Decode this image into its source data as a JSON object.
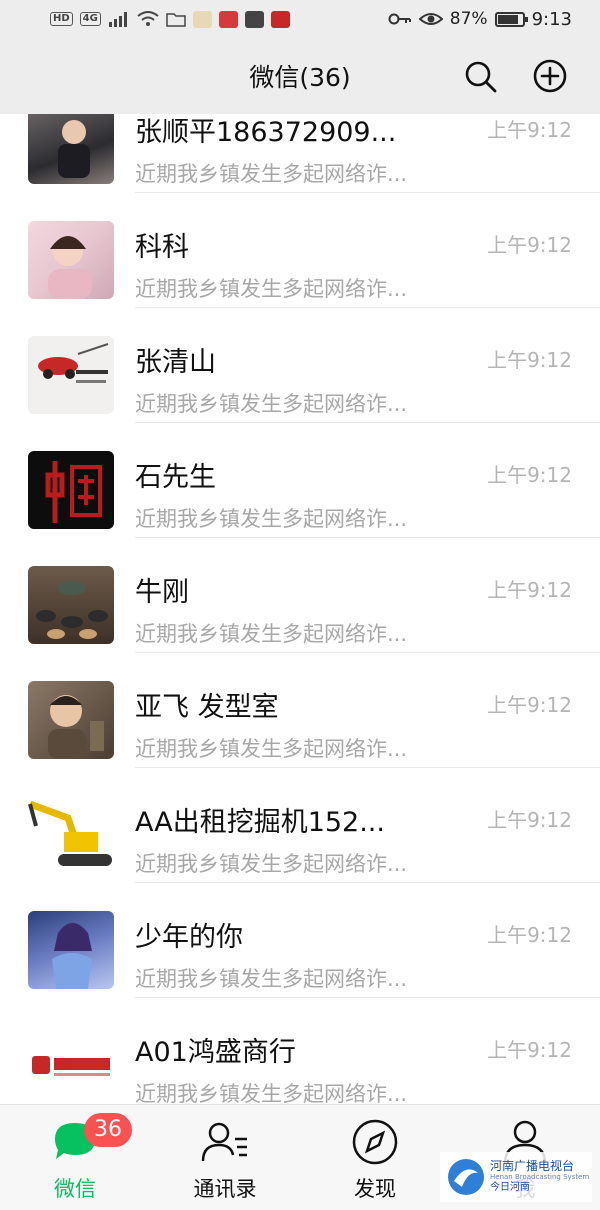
{
  "status_bar": {
    "left_chips": [
      "HD",
      "4G"
    ],
    "battery_percent_label": "87%",
    "battery_level": 0.87,
    "time": "9:13",
    "icons": [
      "signal-icon",
      "wifi-icon",
      "folder-icon",
      "app-icon",
      "app-icon",
      "app-icon",
      "app-icon",
      "key-icon",
      "eye-icon",
      "battery-icon"
    ]
  },
  "header": {
    "title": "微信(36)",
    "search_icon": "search-icon",
    "add_icon": "add-circle-icon"
  },
  "chats": [
    {
      "name": "张顺平186372909...",
      "preview": "近期我乡镇发生多起网络诈...",
      "time": "上午9:12",
      "avatar": "child-photo"
    },
    {
      "name": "科科",
      "preview": "近期我乡镇发生多起网络诈...",
      "time": "上午9:12",
      "avatar": "woman-selfie"
    },
    {
      "name": "张清山",
      "preview": "近期我乡镇发生多起网络诈...",
      "time": "上午9:12",
      "avatar": "car-logo"
    },
    {
      "name": "石先生",
      "preview": "近期我乡镇发生多起网络诈...",
      "time": "上午9:12",
      "avatar": "calligraphy-zhongguo"
    },
    {
      "name": "牛刚",
      "preview": "近期我乡镇发生多起网络诈...",
      "time": "上午9:12",
      "avatar": "tea-set"
    },
    {
      "name": "亚飞 发型室",
      "preview": "近期我乡镇发生多起网络诈...",
      "time": "上午9:12",
      "avatar": "child-portrait"
    },
    {
      "name": "AA出租挖掘机152...",
      "preview": "近期我乡镇发生多起网络诈...",
      "time": "上午9:12",
      "avatar": "excavator"
    },
    {
      "name": "少年的你",
      "preview": "近期我乡镇发生多起网络诈...",
      "time": "上午9:12",
      "avatar": "anime-character"
    },
    {
      "name": "A01鸿盛商行",
      "preview": "近期我乡镇发生多起网络诈...",
      "time": "上午9:12",
      "avatar": "shop-logo"
    }
  ],
  "bottom_nav": {
    "items": [
      {
        "label": "微信",
        "icon": "chat-bubble-icon",
        "active": true,
        "badge": "36"
      },
      {
        "label": "通讯录",
        "icon": "contacts-icon",
        "active": false
      },
      {
        "label": "发现",
        "icon": "compass-icon",
        "active": false
      },
      {
        "label": "我",
        "icon": "person-icon",
        "active": false
      }
    ]
  },
  "colors": {
    "accent_green": "#07c160",
    "badge_red": "#fa5151",
    "header_bg": "#ededed"
  }
}
